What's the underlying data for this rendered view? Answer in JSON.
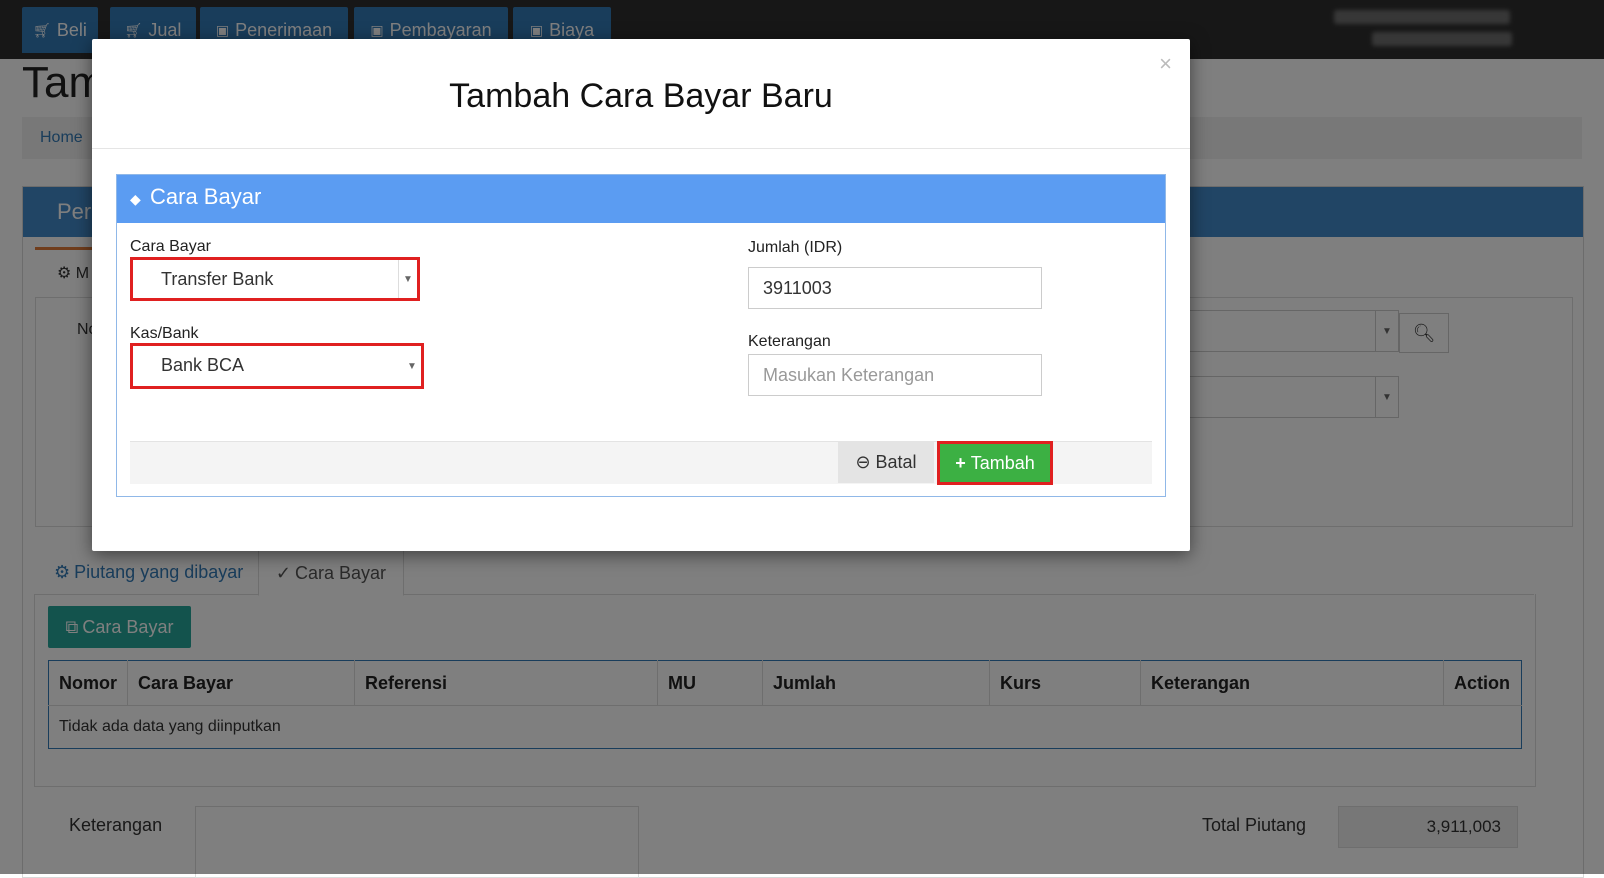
{
  "nav": {
    "tabs": [
      {
        "label": "Beli",
        "icon": "cart-icon"
      },
      {
        "label": "Jual",
        "icon": "cart-icon"
      },
      {
        "label": "Penerimaan",
        "icon": "money-icon"
      },
      {
        "label": "Pembayaran",
        "icon": "money-icon"
      },
      {
        "label": "Biaya",
        "icon": "money-icon"
      }
    ]
  },
  "page": {
    "title_partial": "Tam",
    "breadcrumb_home": "Home",
    "panel_title_partial": "Per",
    "section_partial": "M",
    "field_partial": "No"
  },
  "tabs": {
    "piutang": "Piutang yang dibayar",
    "cara_bayar": "Cara Bayar"
  },
  "cara_bayar_button": "Cara Bayar",
  "table": {
    "headers": [
      "Nomor",
      "Cara Bayar",
      "Referensi",
      "MU",
      "Jumlah",
      "Kurs",
      "Keterangan",
      "Action"
    ],
    "empty_message": "Tidak ada data yang diinputkan"
  },
  "footer": {
    "keterangan_label": "Keterangan",
    "total_label": "Total Piutang",
    "total_value": "3,911,003"
  },
  "modal": {
    "title": "Tambah Cara Bayar Baru",
    "close": "×",
    "panel_title": "Cara Bayar",
    "cara_bayar_label": "Cara Bayar",
    "cara_bayar_value": "Transfer Bank",
    "kas_bank_label": "Kas/Bank",
    "kas_bank_value": "Bank BCA",
    "jumlah_label": "Jumlah (IDR)",
    "jumlah_value": "3911003",
    "keterangan_label": "Keterangan",
    "keterangan_placeholder": "Masukan Keterangan",
    "batal_label": "Batal",
    "tambah_label": "Tambah"
  },
  "colors": {
    "nav_tab": "#337ab7",
    "panel_header": "#5b9cf2",
    "highlight": "#e02020",
    "tambah_button": "#3cb043",
    "teal_button": "#26a69a"
  }
}
